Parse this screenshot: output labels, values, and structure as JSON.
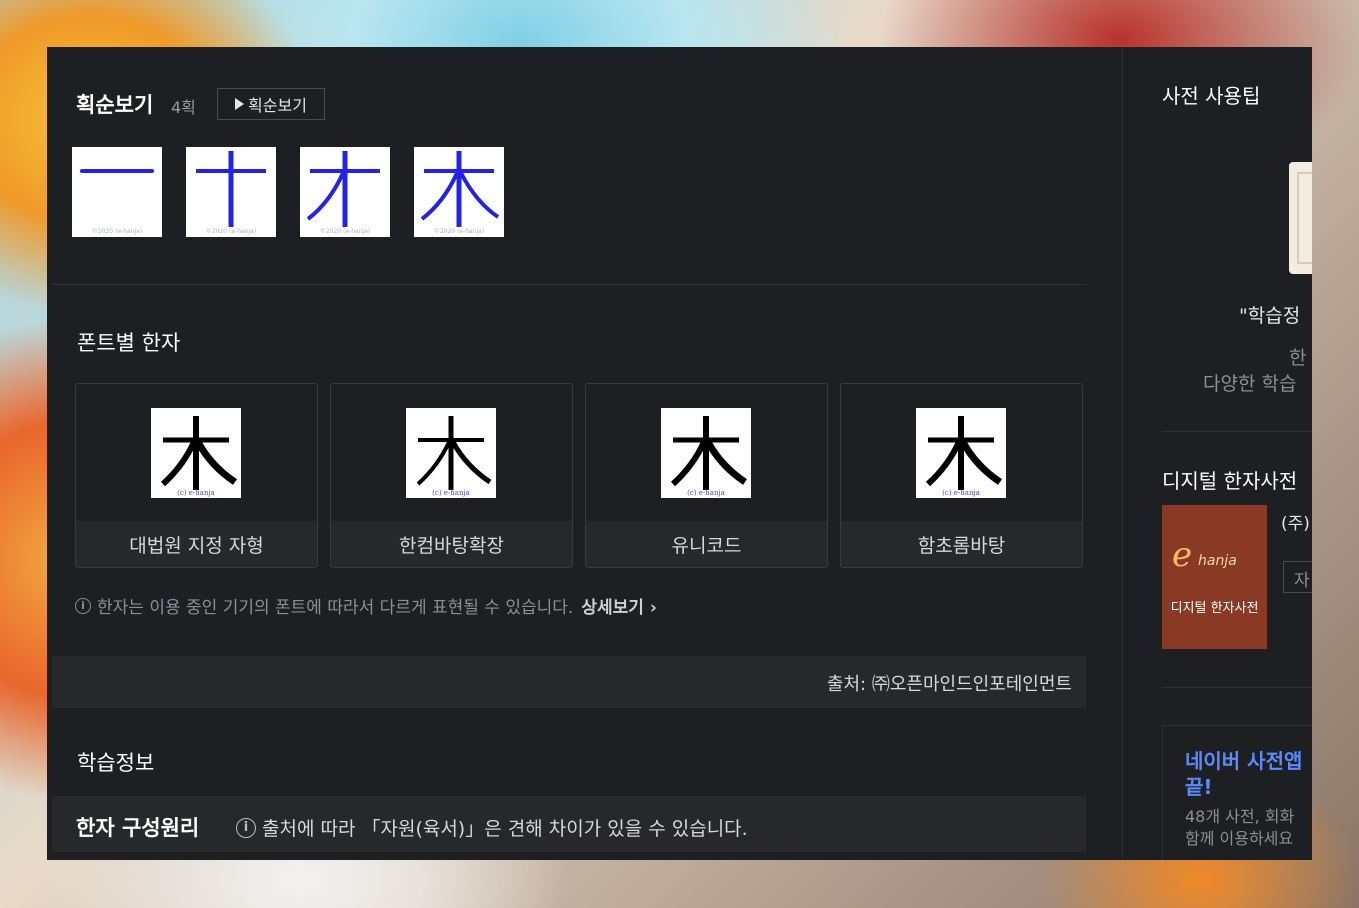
{
  "stroke": {
    "title": "획순보기",
    "count": "4획",
    "button_label": "획순보기",
    "copyright": "©2020 (e-hanja)"
  },
  "fonts": {
    "title": "폰트별 한자",
    "glyph": "木",
    "copyright": "(c) e-hanja",
    "cards": [
      {
        "label": "대법원 지정 자형"
      },
      {
        "label": "한컴바탕확장"
      },
      {
        "label": "유니코드"
      },
      {
        "label": "함초롬바탕"
      }
    ],
    "notice": "한자는 이용 중인 기기의 폰트에 따라서 다르게 표현될 수 있습니다.",
    "more_label": "상세보기",
    "source": "출처: ㈜오픈마인드인포테인먼트"
  },
  "learning": {
    "title": "학습정보",
    "compose_title": "한자 구성원리",
    "compose_note": "출처에 따라 「자원(육서)」은 견해 차이가 있을 수 있습니다."
  },
  "side": {
    "tip_title": "사전 사용팁",
    "tip_quote": "\"학습정",
    "tip_line2": "한",
    "tip_line3": "다양한 학습",
    "dict_title": "디지털 한자사전",
    "logo_e": "e",
    "logo_hanja": "hanja",
    "logo_label": "디지털 한자사전",
    "corp": "(주)",
    "corp_btn": "자",
    "ad_title_1": "네이버 사전앱",
    "ad_title_2": "끝!",
    "ad_desc_1": "48개 사전, 회화",
    "ad_desc_2": "함께 이용하세요"
  }
}
